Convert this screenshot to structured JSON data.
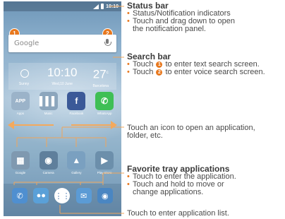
{
  "phone": {
    "status_time": "10:10",
    "search_placeholder": "Google",
    "badge_1": "1",
    "badge_2": "2",
    "weather": {
      "time": "10:10",
      "temp": "27",
      "temp_unit": "c",
      "condition": "Sunny",
      "date": "Wed,10 June",
      "city": "Barcelona"
    },
    "apps_row1": [
      {
        "label": "Apps",
        "glyph": "APP",
        "icon": "apps-folder-icon",
        "color": "#9bb3c9"
      },
      {
        "label": "Music",
        "glyph": "▌▌▌",
        "icon": "music-icon",
        "color": "#8ca6bd"
      },
      {
        "label": "Facebook",
        "glyph": "f",
        "icon": "facebook-icon",
        "color": "#3b5998"
      },
      {
        "label": "WhatsApp",
        "glyph": "✆",
        "icon": "whatsapp-icon",
        "color": "#3fbf55"
      }
    ],
    "apps_row2": [
      {
        "label": "Google",
        "glyph": "▦",
        "icon": "google-folder-icon",
        "color": "#7f99b0"
      },
      {
        "label": "Camera",
        "glyph": "◉",
        "icon": "camera-icon",
        "color": "#5f7f9c"
      },
      {
        "label": "Gallery",
        "glyph": "▲",
        "icon": "gallery-icon",
        "color": "#7aa0c0"
      },
      {
        "label": "Play Store",
        "glyph": "▶",
        "icon": "play-store-icon",
        "color": "#6c8fab"
      }
    ],
    "dock": [
      {
        "glyph": "✆",
        "icon": "phone-icon",
        "color": "#4f8fd0"
      },
      {
        "glyph": "●●",
        "icon": "messaging-icon",
        "color": "#5aa0d8"
      },
      {
        "glyph": "⋮⋮",
        "icon": "app-list-icon",
        "color": "#5a88c0"
      },
      {
        "glyph": "✉",
        "icon": "email-icon",
        "color": "#5b9bd5"
      },
      {
        "glyph": "◉",
        "icon": "browser-icon",
        "color": "#4a86c2"
      }
    ]
  },
  "annotations": {
    "status_bar": {
      "title": "Status bar",
      "bullets": [
        "Status/Notification indicators",
        "Touch and drag down to open",
        "the notification panel."
      ]
    },
    "search_bar": {
      "title": "Search bar",
      "line1_pre": "Touch ",
      "line1_num": "1",
      "line1_post": " to enter text search screen.",
      "line2_pre": "Touch ",
      "line2_num": "2",
      "line2_post": " to enter voice search screen."
    },
    "open_app": {
      "line1": "Touch an icon to open an application,",
      "line2": "folder, etc."
    },
    "favorite_tray": {
      "title": "Favorite tray applications",
      "bullets": [
        "Touch to enter the application.",
        "Touch and hold to move or",
        "change applications."
      ]
    },
    "app_list": "Touch to enter application list."
  },
  "colors": {
    "accent": "#e8781e",
    "arrow": "#f4a95c",
    "connector": "#f0a55a"
  }
}
